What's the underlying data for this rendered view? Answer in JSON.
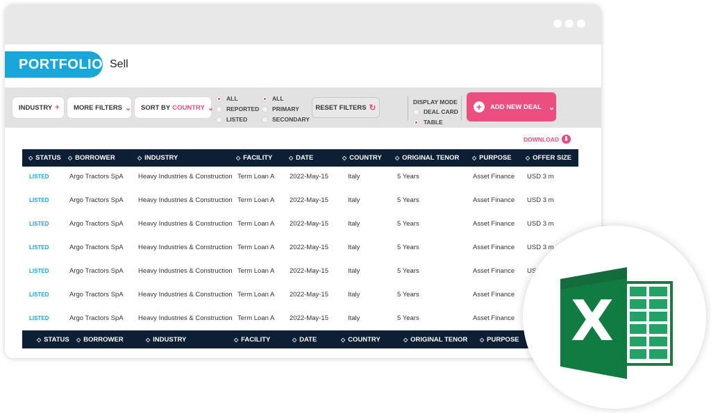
{
  "header": {
    "portfolio_label": "PORTFOLIO",
    "sell_label": "Sell"
  },
  "filters": {
    "industry": "INDUSTRY",
    "industry_symbol": "+",
    "more_filters": "MORE FILTERS",
    "more_filters_symbol": "⌄",
    "sort_by_prefix": "SORT BY",
    "sort_by_value": "COUNTRY",
    "sort_symbol": "⌄",
    "status_group": [
      "ALL",
      "REPORTED",
      "LISTED"
    ],
    "status_selected": "ALL",
    "market_group": [
      "ALL",
      "PRIMARY",
      "SECONDARY"
    ],
    "market_selected": "ALL",
    "reset_filters": "RESET FILTERS",
    "reset_icon": "↻",
    "display_mode_title": "DISPLAY MODE",
    "display_modes": [
      "DEAL CARD",
      "TABLE"
    ],
    "display_mode_selected": "TABLE",
    "add_new_deal": "ADD NEW DEAL",
    "add_symbol": "+",
    "add_chevron": "⌄"
  },
  "download_label": "DOWNLOAD",
  "download_icon": "⬇",
  "sort_glyph": "◇",
  "table": {
    "columns": [
      "STATUS",
      "BORROWER",
      "INDUSTRY",
      "FACILITY",
      "DATE",
      "COUNTRY",
      "ORIGINAL TENOR",
      "PURPOSE",
      "OFFER SIZE"
    ],
    "rows": [
      {
        "status": "LISTED",
        "borrower": "Argo Tractors SpA",
        "industry": "Heavy Industries & Construction",
        "facility": "Term Loan A",
        "date": "2022-May-15",
        "country": "Italy",
        "tenor": "5 Years",
        "purpose": "Asset Finance",
        "offer": "USD 3 m"
      },
      {
        "status": "LISTED",
        "borrower": "Argo Tractors SpA",
        "industry": "Heavy Industries & Construction",
        "facility": "Term Loan A",
        "date": "2022-May-15",
        "country": "Italy",
        "tenor": "5 Years",
        "purpose": "Asset Finance",
        "offer": "USD 3 m"
      },
      {
        "status": "LISTED",
        "borrower": "Argo Tractors SpA",
        "industry": "Heavy Industries & Construction",
        "facility": "Term Loan A",
        "date": "2022-May-15",
        "country": "Italy",
        "tenor": "5 Years",
        "purpose": "Asset Finance",
        "offer": "USD 3 m"
      },
      {
        "status": "LISTED",
        "borrower": "Argo Tractors SpA",
        "industry": "Heavy Industries & Construction",
        "facility": "Term Loan A",
        "date": "2022-May-15",
        "country": "Italy",
        "tenor": "5 Years",
        "purpose": "Asset Finance",
        "offer": "USD 3 m"
      },
      {
        "status": "LISTED",
        "borrower": "Argo Tractors SpA",
        "industry": "Heavy Industries & Construction",
        "facility": "Term Loan A",
        "date": "2022-May-15",
        "country": "Italy",
        "tenor": "5 Years",
        "purpose": "Asset Finance",
        "offer": "USD"
      },
      {
        "status": "LISTED",
        "borrower": "Argo Tractors SpA",
        "industry": "Heavy Industries & Construction",
        "facility": "Term Loan A",
        "date": "2022-May-15",
        "country": "Italy",
        "tenor": "5 Years",
        "purpose": "Asset Finance",
        "offer": ""
      },
      {
        "status": "LISTED",
        "borrower": "Argo Tractors SpA",
        "industry": "Heavy Industries & Construction",
        "facility": "Term Loan A",
        "date": "2022-May-15",
        "country": "Italy",
        "tenor": "5 Years",
        "purpose": "Asset Finance",
        "offer": ""
      }
    ],
    "footer_columns": [
      "STATUS",
      "BORROWER",
      "INDUSTRY",
      "FACILITY",
      "DATE",
      "COUNTRY",
      "ORIGINAL TENOR",
      "PURPOSE"
    ]
  },
  "excel_badge": {
    "icon": "microsoft-excel-icon",
    "letter": "X",
    "colors": {
      "dark": "#185c37",
      "mid": "#107c41",
      "light": "#21a366"
    }
  },
  "colors": {
    "accent_blue": "#19a6d8",
    "accent_pink": "#ec4e80",
    "table_header": "#0d1f34"
  }
}
